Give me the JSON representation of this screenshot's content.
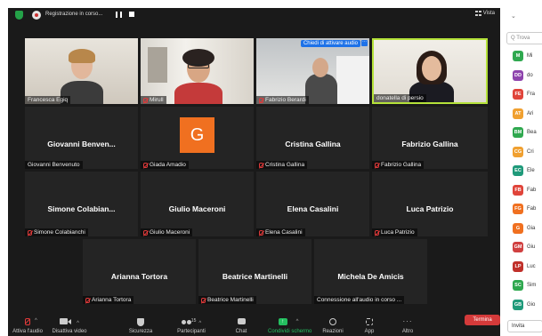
{
  "topbar": {
    "recording": "Registrazione in corso...",
    "view": "Vista"
  },
  "videos": [
    {
      "name": "Francesca Egiq",
      "muted": false
    },
    {
      "name": "Mirull",
      "muted": true
    },
    {
      "name": "Fabrizio Berardi",
      "muted": true,
      "banner": "Chiedi di attivare audio"
    },
    {
      "name": "donatella di persio",
      "muted": false
    }
  ],
  "tiles_row2": [
    {
      "big": "Giovanni  Benven...",
      "name": "Giovanni Benvenuto",
      "muted": false
    },
    {
      "initial": "G",
      "name": "Giada Amadio",
      "muted": true
    },
    {
      "big": "Cristina Gallina",
      "name": "Cristina Gallina",
      "muted": true
    },
    {
      "big": "Fabrizio Gallina",
      "name": "Fabrizio Gallina",
      "muted": true
    }
  ],
  "tiles_row3": [
    {
      "big": "Simone  Colabian...",
      "name": "Simone Colabianchi",
      "muted": true
    },
    {
      "big": "Giulio Maceroni",
      "name": "Giulio Maceroni",
      "muted": true
    },
    {
      "big": "Elena Casalini",
      "name": "Elena Casalini",
      "muted": true
    },
    {
      "big": "Luca Patrizio",
      "name": "Luca Patrizio",
      "muted": true
    }
  ],
  "tiles_row4": [
    {
      "big": "Arianna Tortora",
      "name": "Arianna Tortora",
      "muted": true
    },
    {
      "big": "Beatrice Martinelli",
      "name": "Beatrice Martinelli",
      "muted": true
    },
    {
      "big": "Michela De Amicis",
      "name": "Connessione all'audio in corso ...",
      "muted": false
    }
  ],
  "toolbar": {
    "audio": "Attiva l'audio",
    "video": "Disattiva video",
    "security": "Sicurezza",
    "participants": "Partecipanti",
    "participants_count": "15",
    "chat": "Chat",
    "share": "Condividi schermo",
    "reactions": "Reazioni",
    "apps": "App",
    "more": "Altro",
    "end": "Termina"
  },
  "sidebar": {
    "search_placeholder": "Q Trova",
    "invite": "Invita",
    "participants": [
      {
        "initials": "M",
        "text": "Mi",
        "color": "#2fa84f"
      },
      {
        "initials": "DD",
        "text": "do",
        "color": "#8e44ad"
      },
      {
        "initials": "FE",
        "text": "Fra",
        "color": "#e0443a"
      },
      {
        "initials": "AT",
        "text": "Ari",
        "color": "#f0a030"
      },
      {
        "initials": "BM",
        "text": "Bea",
        "color": "#2fa84f"
      },
      {
        "initials": "CG",
        "text": "Cri",
        "color": "#f0a030"
      },
      {
        "initials": "EC",
        "text": "Ele",
        "color": "#1f9a7a"
      },
      {
        "initials": "FB",
        "text": "Fab",
        "color": "#e0443a"
      },
      {
        "initials": "FG",
        "text": "Fab",
        "color": "#f07020"
      },
      {
        "initials": "G",
        "text": "Gia",
        "color": "#f07020"
      },
      {
        "initials": "GM",
        "text": "Giu",
        "color": "#d04040"
      },
      {
        "initials": "LP",
        "text": "Luc",
        "color": "#c0302a"
      },
      {
        "initials": "SC",
        "text": "Sim",
        "color": "#2fa84f"
      },
      {
        "initials": "GB",
        "text": "Gio",
        "color": "#1f9a7a"
      }
    ]
  }
}
